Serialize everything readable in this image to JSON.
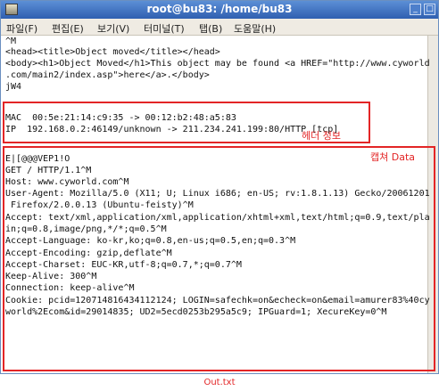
{
  "window": {
    "title": "root@bu83: /home/bu83",
    "min_glyph": "_",
    "max_glyph": "□"
  },
  "menu": [
    "파일(F)",
    "편집(E)",
    "보기(V)",
    "터미널(T)",
    "탭(B)",
    "도움말(H)"
  ],
  "terminal_top": [
    "^M",
    "<head><title>Object moved</title></head>",
    "<body><h1>Object Moved</h1>This object may be found <a HREF=\"http://www.cyworld",
    ".com/main2/index.asp\">here</a>.</body>",
    "jW4"
  ],
  "header_info": [
    "MAC  00:5e:21:14:c9:35 -> 00:12:b2:48:a5:83",
    "IP  192.168.0.2:46149/unknown -> 211.234.241.199:80/HTTP [tcp]"
  ],
  "header_label": "헤더 정보",
  "capture_label": "캡쳐 Data",
  "capture_data": [
    "E|[@@@VEP1!O",
    "GET / HTTP/1.1^M",
    "Host: www.cyworld.com^M",
    "User-Agent: Mozilla/5.0 (X11; U; Linux i686; en-US; rv:1.8.1.13) Gecko/20061201",
    " Firefox/2.0.0.13 (Ubuntu-feisty)^M",
    "Accept: text/xml,application/xml,application/xhtml+xml,text/html;q=0.9,text/pla",
    "in;q=0.8,image/png,*/*;q=0.5^M",
    "Accept-Language: ko-kr,ko;q=0.8,en-us;q=0.5,en;q=0.3^M",
    "Accept-Encoding: gzip,deflate^M",
    "Accept-Charset: EUC-KR,utf-8;q=0.7,*;q=0.7^M",
    "Keep-Alive: 300^M",
    "Connection: keep-alive^M",
    "Cookie: pcid=120714816434112124; LOGIN=safechk=on&echeck=on&email=amurer83%40cy",
    "world%2Ecom&id=29014835; UD2=5ecd0253b295a5c9; IPGuard=1; XecureKey=0^M"
  ],
  "caption": "Out.txt",
  "colors": {
    "annotation": "#e32526",
    "titlebar": "#3f6fc0"
  }
}
